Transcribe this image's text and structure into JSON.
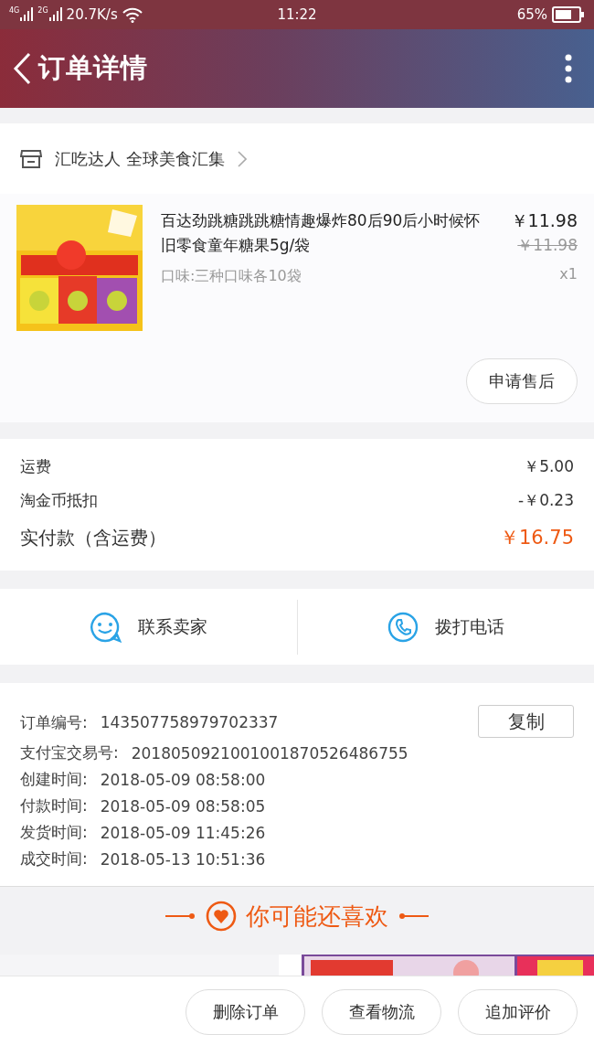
{
  "status_bar": {
    "network_1": "4G",
    "network_2": "2G",
    "speed": "20.7K/s",
    "time": "11:22",
    "battery_percent": "65%"
  },
  "header": {
    "title": "订单详情"
  },
  "shop": {
    "name": "汇吃达人 全球美食汇集"
  },
  "product": {
    "title": "百达劲跳糖跳跳糖情趣爆炸80后90后小时候怀旧零食童年糖果5g/袋",
    "variant": "口味:三种口味各10袋",
    "price": "￥11.98",
    "original_price": "￥11.98",
    "quantity": "x1",
    "action": "申请售后"
  },
  "fees": [
    {
      "label": "运费",
      "value": "￥5.00",
      "kind": "normal"
    },
    {
      "label": "淘金币抵扣",
      "value": "-￥0.23",
      "kind": "normal"
    },
    {
      "label": "实付款（含运费）",
      "value": "￥16.75",
      "kind": "total"
    }
  ],
  "contact": [
    {
      "label": "联系卖家",
      "kind": "chat"
    },
    {
      "label": "拨打电话",
      "kind": "phone"
    }
  ],
  "order_info": {
    "copy_button": "复制",
    "rows": [
      {
        "label": "订单编号:",
        "value": "143507758979702337"
      },
      {
        "label": "支付宝交易号:",
        "value": "2018050921001001870526486755"
      },
      {
        "label": "创建时间:",
        "value": "2018-05-09 08:58:00"
      },
      {
        "label": "付款时间:",
        "value": "2018-05-09 08:58:05"
      },
      {
        "label": "发货时间:",
        "value": "2018-05-09 11:45:26"
      },
      {
        "label": "成交时间:",
        "value": "2018-05-13 10:51:36"
      }
    ]
  },
  "recommend": {
    "title": "你可能还喜欢"
  },
  "bottom_actions": [
    "删除订单",
    "查看物流",
    "追加评价"
  ]
}
